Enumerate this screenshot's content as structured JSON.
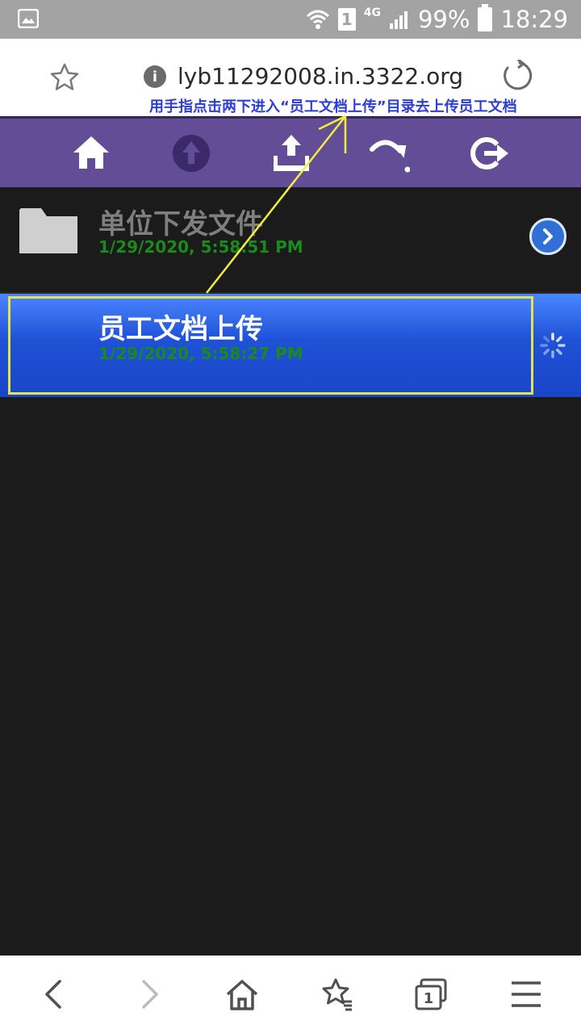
{
  "status_bar": {
    "battery_percent": "99%",
    "time": "18:29",
    "sim_slot": "1",
    "network": "4G",
    "icons": [
      "gallery-icon",
      "wifi-icon",
      "sim-icon",
      "signal-icon",
      "battery-icon"
    ]
  },
  "browser": {
    "url": "lyb11292008.in.3322.org",
    "info_glyph": "i",
    "icons": [
      "bookmark-star-icon",
      "info-icon",
      "reload-icon"
    ]
  },
  "annotation": {
    "hint_text": "用手指点击两下进入“员工文档上传”目录去上传员工文档",
    "arrow_color": "#f2ee3c",
    "highlight_color": "#e8e24a"
  },
  "toolbar": {
    "icons": [
      "home-icon",
      "up-icon",
      "upload-icon",
      "redirect-icon",
      "logout-icon"
    ],
    "color": "#634d96"
  },
  "files": [
    {
      "name": "单位下发文件",
      "date": "1/29/2020, 5:58:51 PM",
      "selected": false,
      "icon": "folder-icon",
      "action_icon": "chevron-right-icon"
    },
    {
      "name": "员工文档上传",
      "date": "1/29/2020, 5:58:27 PM",
      "selected": true,
      "icon": "none",
      "action_icon": "loading-spinner-icon"
    }
  ],
  "bottom_nav": {
    "tabs_count": "1",
    "icons": [
      "back-icon",
      "forward-icon",
      "home-icon",
      "bookmarks-icon",
      "tabs-icon",
      "menu-icon"
    ]
  }
}
